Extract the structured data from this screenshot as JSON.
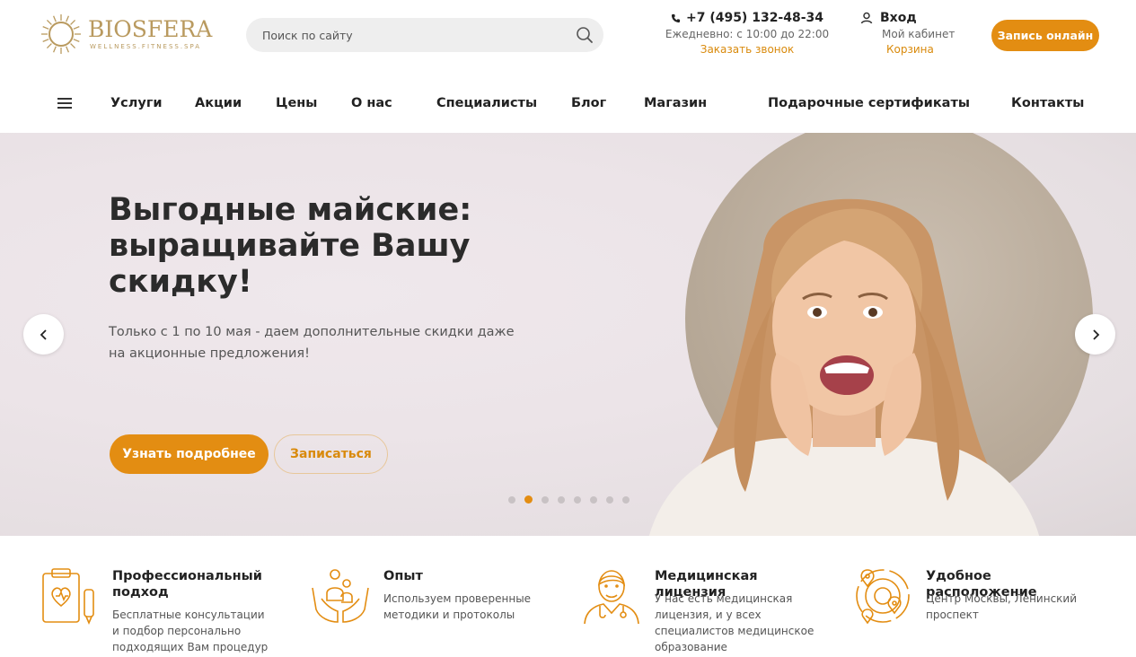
{
  "brand": {
    "name": "BIOSFERA",
    "tagline": "WELLNESS.FITNESS.SPA",
    "accent": "#e38d12",
    "gold": "#b99a5f"
  },
  "search": {
    "placeholder": "Поиск по сайту",
    "icon": "search-icon"
  },
  "contact": {
    "phone": "+7 (495) 132-48-34",
    "hours": "Ежедневно: с 10:00 до 22:00",
    "callback": "Заказать звонок",
    "phone_icon": "phone-icon"
  },
  "account": {
    "login": "Вход",
    "cabinet": "Мой кабинет",
    "cart": "Корзина",
    "user_icon": "user-icon"
  },
  "book_button": "Запись онлайн",
  "nav": {
    "menu_icon": "menu-icon",
    "items": [
      "Услуги",
      "Акции",
      "Цены",
      "О нас",
      "Специалисты",
      "Блог",
      "Магазин",
      "Подарочные сертификаты",
      "Контакты"
    ]
  },
  "hero": {
    "title": "Выгодные майские:\nвыращивайте Вашу\nскидку!",
    "subtitle": "Только с 1 по 10 мая - даем дополнительные скидки даже на акционные предложения!",
    "primary_button": "Узнать подробнее",
    "secondary_button": "Записаться",
    "slide_count": 8,
    "active_slide": 2
  },
  "features": [
    {
      "icon": "clipboard-heart-icon",
      "title": "Профессиональный\nподход",
      "text": "Бесплатные консультации и подбор персонально подходящих Вам процедур"
    },
    {
      "icon": "caring-hands-icon",
      "title": "Опыт",
      "text": "Используем проверенные методики и протоколы"
    },
    {
      "icon": "doctor-icon",
      "title": "Медицинская лицензия",
      "text": "У нас есть медицинская лицензия, и у всех специалистов медицинское образование"
    },
    {
      "icon": "location-target-icon",
      "title": "Удобное расположение",
      "text": "Центр Москвы, Ленинский проспект"
    }
  ]
}
